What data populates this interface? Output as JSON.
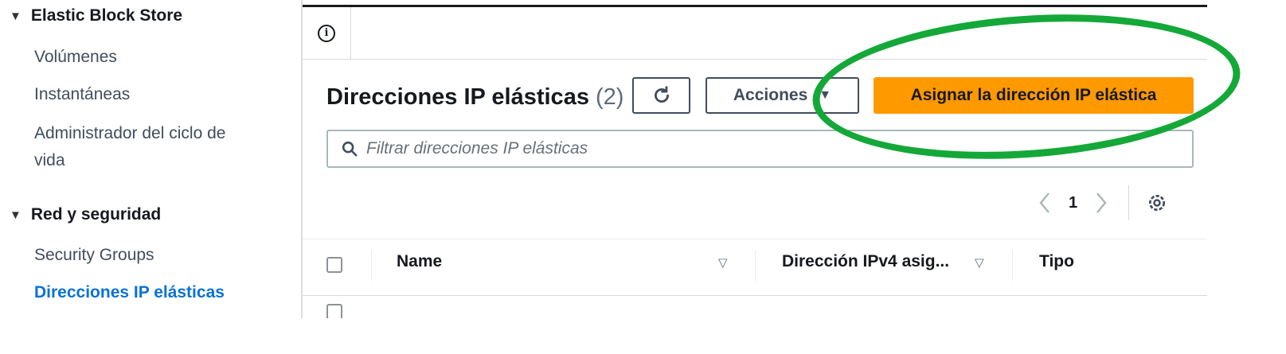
{
  "sidebar": {
    "sections": [
      {
        "title": "Elastic Block Store",
        "items": [
          "Volúmenes",
          "Instantáneas",
          "Administrador del ciclo de vida"
        ]
      },
      {
        "title": "Red y seguridad",
        "items": [
          "Security Groups",
          "Direcciones IP elásticas"
        ]
      }
    ],
    "active_item": "Direcciones IP elásticas",
    "lifecycle_line1": "Administrador del ciclo de",
    "lifecycle_line2": "vida"
  },
  "header": {
    "title": "Direcciones IP elásticas",
    "count": "(2)",
    "actions_label": "Acciones",
    "primary_label": "Asignar la dirección IP elástica"
  },
  "search": {
    "placeholder": "Filtrar direcciones IP elásticas"
  },
  "pagination": {
    "current_page": "1"
  },
  "table": {
    "columns": [
      "Name",
      "Dirección IPv4 asig...",
      "Tipo"
    ]
  },
  "colors": {
    "primary": "#ff9900",
    "link": "#0972d3",
    "annotation": "#14a838"
  },
  "icons": [
    "triangle-down-icon",
    "info-icon",
    "refresh-icon",
    "caret-down-icon",
    "search-icon",
    "chevron-left-icon",
    "chevron-right-icon",
    "settings-icon",
    "sort-icon"
  ]
}
